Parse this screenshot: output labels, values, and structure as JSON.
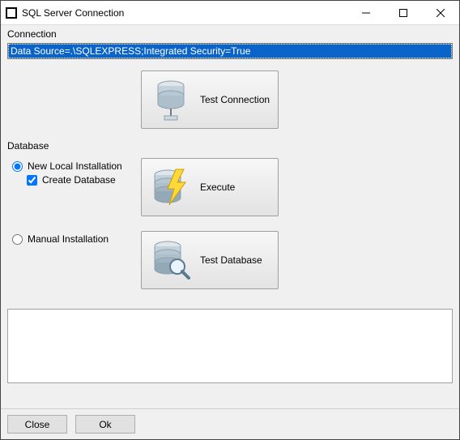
{
  "window": {
    "title": "SQL Server Connection"
  },
  "connection": {
    "label": "Connection",
    "value": "Data Source=.\\SQLEXPRESS;Integrated Security=True",
    "test_button": "Test Connection"
  },
  "database": {
    "label": "Database",
    "new_local_label": "New Local Installation",
    "new_local_selected": true,
    "create_db_label": "Create Database",
    "create_db_checked": true,
    "execute_button": "Execute",
    "manual_label": "Manual Installation",
    "manual_selected": false,
    "test_db_button": "Test Database"
  },
  "output": {
    "text": ""
  },
  "footer": {
    "close": "Close",
    "ok": "Ok"
  }
}
